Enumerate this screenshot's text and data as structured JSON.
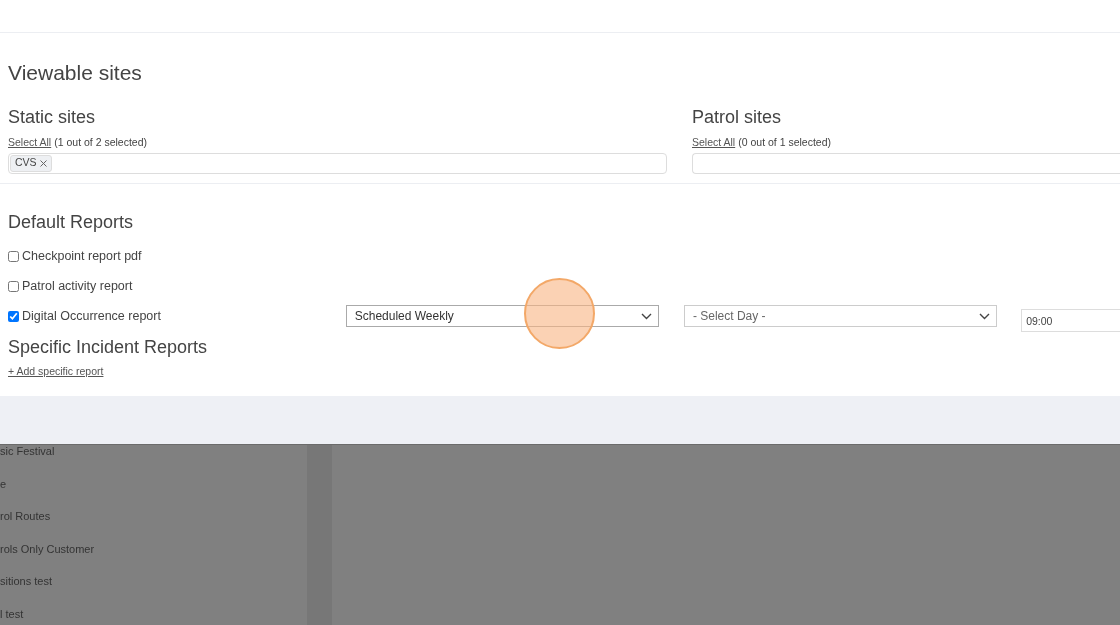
{
  "viewable_sites": {
    "title": "Viewable sites",
    "groups": [
      {
        "title": "Static sites",
        "select_all": "Select All",
        "count": "(1 out of 2 selected)",
        "tags": [
          "CVS"
        ]
      },
      {
        "title": "Patrol sites",
        "select_all": "Select All",
        "count": "(0 out of 1 selected)"
      }
    ]
  },
  "default_reports": {
    "title": "Default Reports",
    "items": [
      {
        "label": "Checkpoint report pdf",
        "checked": false
      },
      {
        "label": "Patrol activity report",
        "checked": false
      },
      {
        "label": "Digital Occurrence report",
        "checked": true,
        "schedule": "Scheduled Weekly",
        "day": "- Select Day -",
        "time": "09:00"
      }
    ]
  },
  "specific_incident_reports": {
    "title": "Specific Incident Reports",
    "add_link": "+ Add specific report"
  },
  "background_list": [
    "sic Festival",
    "e",
    "rol Routes",
    "rols Only Customer",
    "sitions test",
    "l test"
  ]
}
